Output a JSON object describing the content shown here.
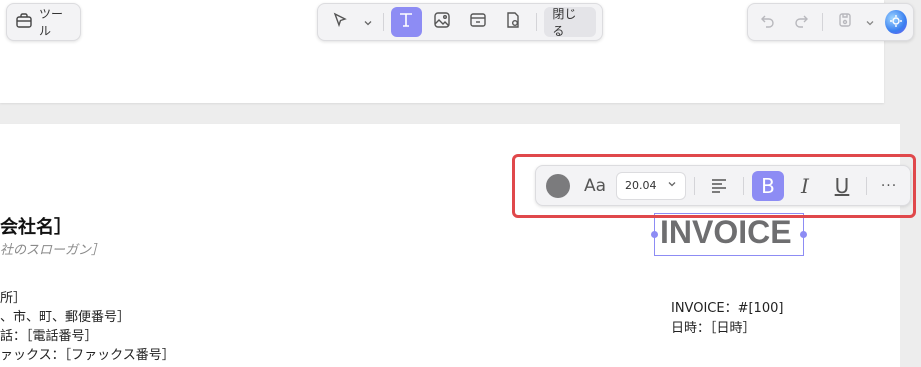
{
  "toolbar": {
    "tool_label": "ツール",
    "close_label": "閉じる"
  },
  "format_bar": {
    "text_color": "#7b7b7d",
    "font_label": "Aa",
    "font_size": "20.04",
    "bold_label": "B",
    "italic_label": "I",
    "underline_label": "U",
    "more_label": "···"
  },
  "colors": {
    "accent": "#8d8cf4",
    "highlight": "#e0484b"
  },
  "document": {
    "company_name": "会社名］",
    "slogan": "社のスローガン］",
    "address_lines": [
      "所］",
      "、市、町、郵便番号］",
      "話：［電話番号］",
      "ァックス：［ファックス番号］"
    ],
    "invoice_title": "INVOICE",
    "invoice_number": "INVOICE：#[100]",
    "date": "日時：［日時］"
  }
}
